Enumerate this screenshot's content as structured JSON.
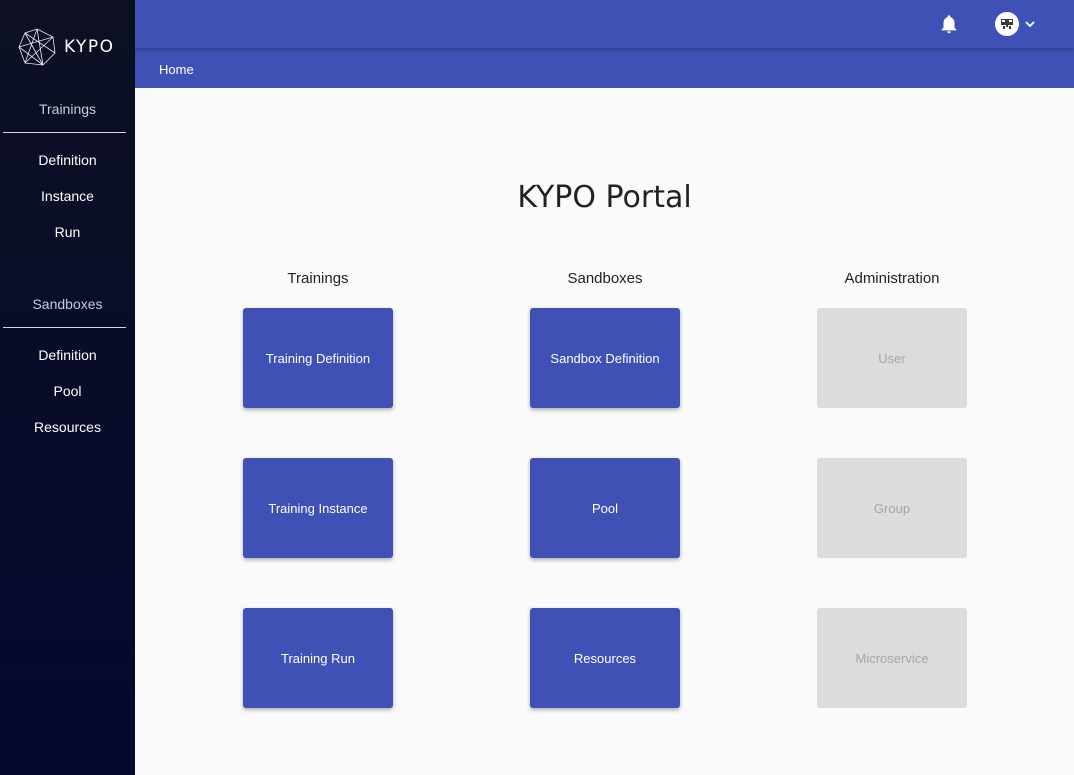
{
  "app": {
    "logo_text": "KYPO"
  },
  "sidebar": {
    "groups": [
      {
        "title": "Trainings",
        "items": [
          "Definition",
          "Instance",
          "Run"
        ]
      },
      {
        "title": "Sandboxes",
        "items": [
          "Definition",
          "Pool",
          "Resources"
        ]
      }
    ]
  },
  "header": {
    "icons": [
      "bell-icon",
      "avatar",
      "chevron-down-icon"
    ]
  },
  "breadcrumb": {
    "home": "Home"
  },
  "main": {
    "title": "KYPO Portal",
    "columns": [
      {
        "title": "Trainings",
        "tiles": [
          "Training Definition",
          "Training Instance",
          "Training Run"
        ],
        "state": "enabled"
      },
      {
        "title": "Sandboxes",
        "tiles": [
          "Sandbox Definition",
          "Pool",
          "Resources"
        ],
        "state": "enabled"
      },
      {
        "title": "Administration",
        "tiles": [
          "User",
          "Group",
          "Microservice"
        ],
        "state": "disabled"
      }
    ]
  },
  "colors": {
    "primary": "#3f51b5",
    "sidebar": "#080b2a",
    "disabled_tile": "#dcdcdc",
    "disabled_text": "#a6a6a6"
  }
}
